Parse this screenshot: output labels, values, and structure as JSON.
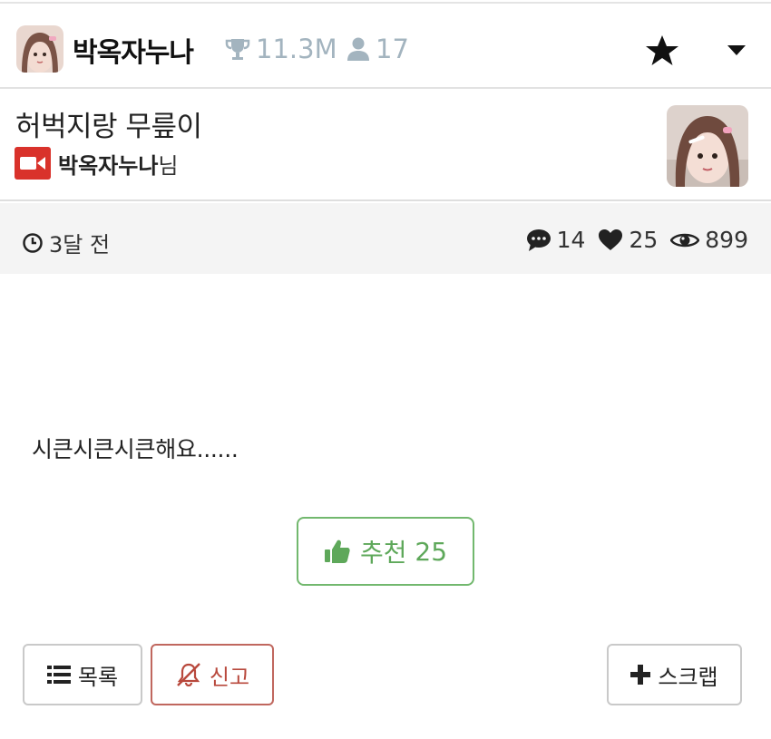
{
  "header": {
    "channel_name": "박옥자누나",
    "trophy_count": "11.3M",
    "user_count": "17",
    "icons": [
      "trophy-icon",
      "user-icon",
      "star-icon",
      "caret-down-icon"
    ]
  },
  "post": {
    "title": "허벅지랑 무릎이",
    "author_name": "박옥자누나",
    "author_suffix": "님",
    "time_ago": "3달 전",
    "comments": "14",
    "likes": "25",
    "views": "899",
    "body_text": "시큰시큰시큰해요......"
  },
  "actions": {
    "recommend_label": "추천",
    "recommend_count": "25",
    "list_label": "목록",
    "report_label": "신고",
    "scrap_label": "스크랩"
  },
  "colors": {
    "accent_green": "#5ea85a",
    "report_red": "#b8483c",
    "cam_red": "#d9322b",
    "muted_blue_gray": "#a3b4bf"
  }
}
